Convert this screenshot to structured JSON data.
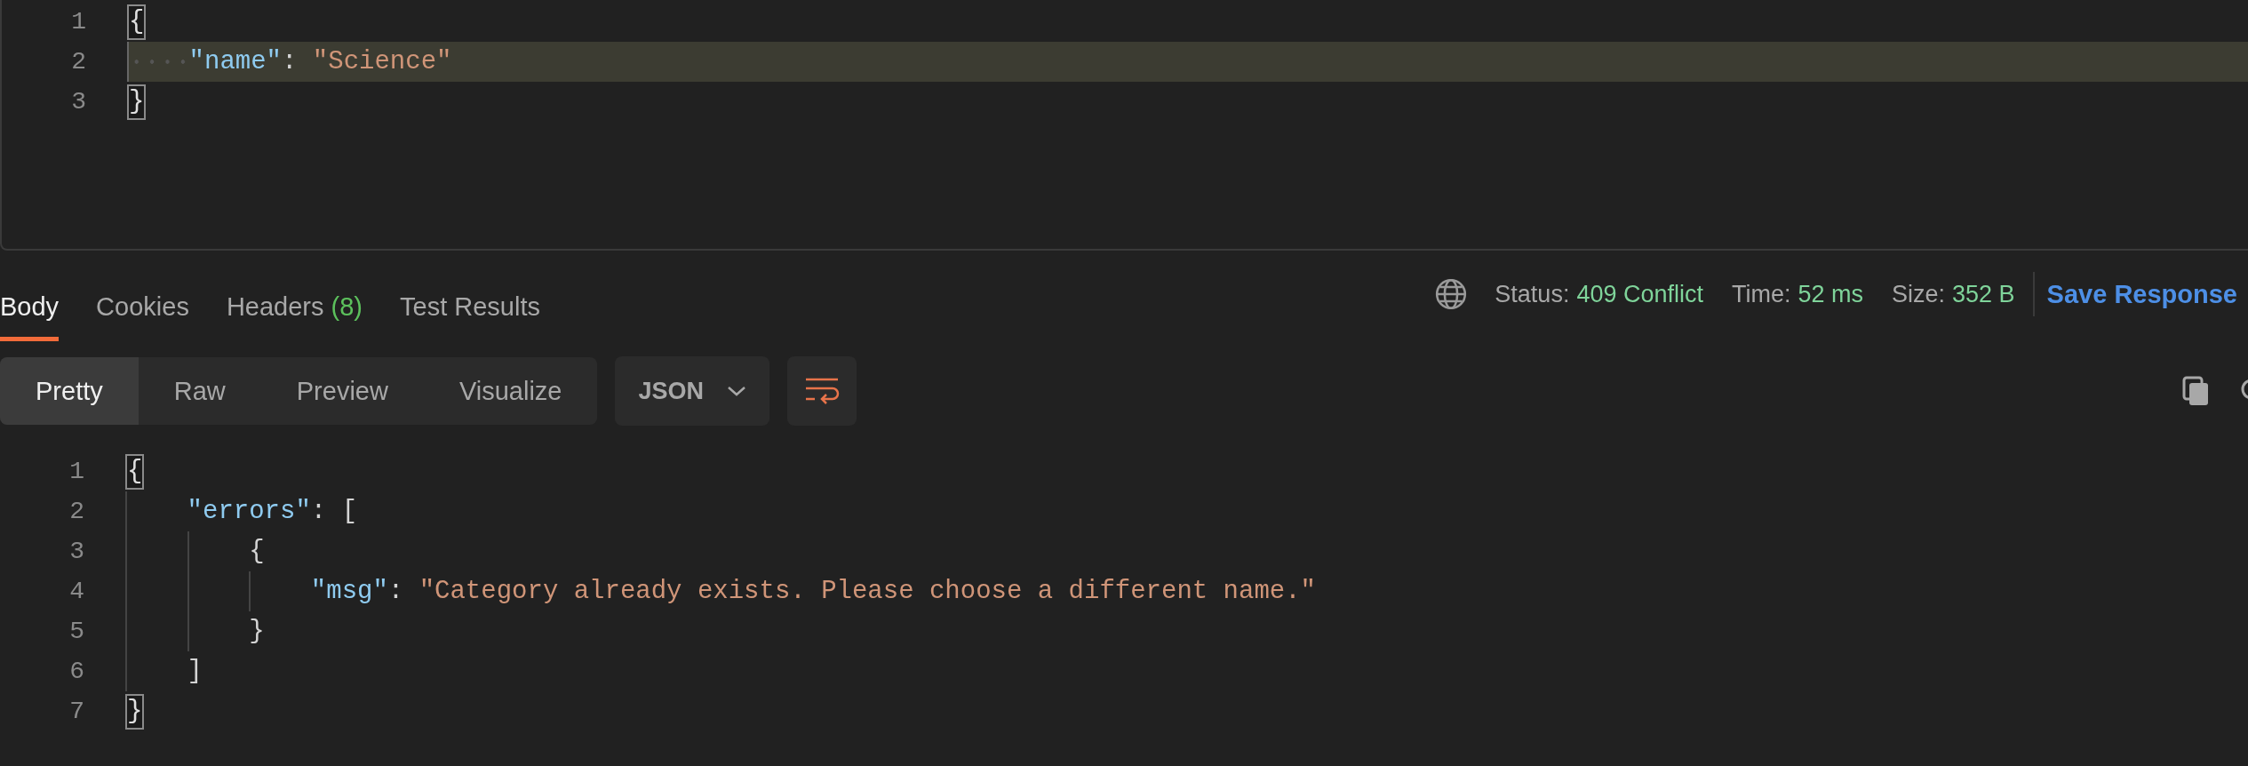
{
  "request_editor": {
    "lines": [
      {
        "number": "1",
        "highlighted": false,
        "tokens": [
          {
            "kind": "bracket-match",
            "text": "{"
          }
        ],
        "children": [
          {
            "number": "2",
            "highlighted": true,
            "tokens": [
              {
                "kind": "key",
                "text": "\"name\""
              },
              {
                "kind": "punct",
                "text": ": "
              },
              {
                "kind": "string",
                "text": "\"Science\""
              }
            ]
          }
        ]
      },
      {
        "number": "3",
        "highlighted": false,
        "tokens": [
          {
            "kind": "bracket-match",
            "text": "}"
          }
        ]
      }
    ]
  },
  "response": {
    "tabs": [
      {
        "label": "Body",
        "selected": true
      },
      {
        "label": "Cookies",
        "selected": false
      },
      {
        "label": "Headers",
        "count": "(8)",
        "selected": false
      },
      {
        "label": "Test Results",
        "selected": false
      }
    ],
    "metrics": [
      {
        "label": "Status:",
        "value": "409 Conflict"
      },
      {
        "label": "Time:",
        "value": "52 ms"
      },
      {
        "label": "Size:",
        "value": "352 B"
      }
    ],
    "save_button": "Save Response",
    "view_modes": [
      {
        "label": "Pretty",
        "selected": true
      },
      {
        "label": "Raw",
        "selected": false
      },
      {
        "label": "Preview",
        "selected": false
      },
      {
        "label": "Visualize",
        "selected": false
      }
    ],
    "format": "JSON",
    "word_wrap_on": true,
    "editor": {
      "lines": [
        {
          "number": "1",
          "highlighted": false,
          "tokens": [
            {
              "kind": "bracket-match",
              "text": "{"
            }
          ],
          "children": [
            {
              "number": "2",
              "highlighted": false,
              "tokens": [
                {
                  "kind": "key",
                  "text": "\"errors\""
                },
                {
                  "kind": "punct",
                  "text": ": ["
                }
              ],
              "children": [
                {
                  "number": "3",
                  "highlighted": false,
                  "tokens": [
                    {
                      "kind": "punct",
                      "text": "{"
                    }
                  ],
                  "children": [
                    {
                      "number": "4",
                      "highlighted": false,
                      "tokens": [
                        {
                          "kind": "key",
                          "text": "\"msg\""
                        },
                        {
                          "kind": "punct",
                          "text": ": "
                        },
                        {
                          "kind": "string",
                          "text": "\"Category already exists. Please choose a different name.\""
                        }
                      ]
                    }
                  ]
                },
                {
                  "number": "5",
                  "highlighted": false,
                  "tokens": [
                    {
                      "kind": "punct",
                      "text": "}"
                    }
                  ]
                }
              ]
            },
            {
              "number": "6",
              "highlighted": false,
              "tokens": [
                {
                  "kind": "punct",
                  "text": "]"
                }
              ]
            }
          ]
        },
        {
          "number": "7",
          "highlighted": false,
          "tokens": [
            {
              "kind": "bracket-match",
              "text": "}"
            }
          ]
        }
      ]
    }
  }
}
